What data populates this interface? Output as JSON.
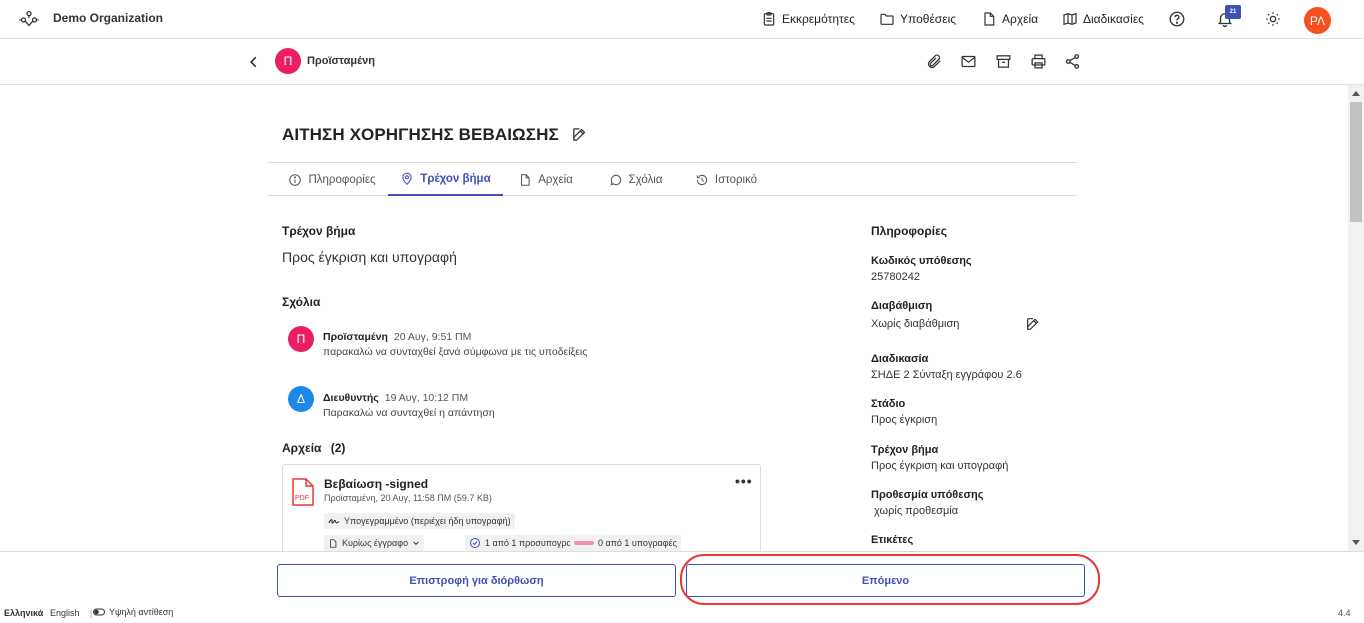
{
  "header": {
    "org_name": "Demo Organization",
    "nav": [
      {
        "label": "Εκκρεμότητες",
        "icon": "clipboard-icon"
      },
      {
        "label": "Υποθέσεις",
        "icon": "folder-icon"
      },
      {
        "label": "Αρχεία",
        "icon": "file-icon"
      },
      {
        "label": "Διαδικασίες",
        "icon": "map-icon"
      }
    ],
    "notifications_count": "21",
    "user_initials": "ΡΛ"
  },
  "subheader": {
    "avatar_letter": "Π",
    "user_name": "Προϊσταμένη"
  },
  "document": {
    "title": "ΑΙΤΗΣΗ ΧΟΡΗΓΗΣΗΣ ΒΕΒΑΙΩΣΗΣ",
    "tabs": [
      {
        "label": "Πληροφορίες"
      },
      {
        "label": "Τρέχον βήμα"
      },
      {
        "label": "Αρχεία"
      },
      {
        "label": "Σχόλια"
      },
      {
        "label": "Ιστορικό"
      }
    ],
    "active_tab": "Τρέχον βήμα"
  },
  "current_step": {
    "heading": "Τρέχον βήμα",
    "value": "Προς έγκριση και υπογραφή"
  },
  "comments": {
    "heading": "Σχόλια",
    "items": [
      {
        "avatar": "Π",
        "author": "Προϊσταμένη",
        "time": "20 Αυγ, 9:51 ΠΜ",
        "text": "παρακαλώ να συνταχθεί ξανά σύμφωνα με τις υποδείξεις",
        "color": "#e91e63"
      },
      {
        "avatar": "Δ",
        "author": "Διευθυντής",
        "time": "19 Αυγ, 10:12 ΠΜ",
        "text": "Παρακαλώ να συνταχθεί η απάντηση",
        "color": "#1e88e5"
      }
    ]
  },
  "files": {
    "heading": "Αρχεία",
    "count": "(2)",
    "items": [
      {
        "icon_label": "PDF",
        "name": "Βεβαίωση -signed",
        "meta": "Προϊσταμένη,  20 Αυγ, 11:58 ΠΜ (59.7 KB)",
        "signed_label": "Υπογεγραμμένο (περιέχει ήδη υπογραφή)",
        "type_label": "Κυρίως έγγραφο",
        "initials_label": "1 από 1 προσυπογραφές",
        "signatures_label": "0 από 1 υπογραφές"
      }
    ]
  },
  "info": {
    "heading": "Πληροφορίες",
    "fields": [
      {
        "label": "Κωδικός υπόθεσης",
        "value": "25780242"
      },
      {
        "label": "Διαβάθμιση",
        "value": "Χωρίς διαβάθμιση"
      },
      {
        "label": "Διαδικασία",
        "value": "ΣΗΔΕ 2 Σύνταξη εγγράφου 2.6"
      },
      {
        "label": "Στάδιο",
        "value": "Προς έγκριση"
      },
      {
        "label": "Τρέχον βήμα",
        "value": "Προς έγκριση και υπογραφή"
      },
      {
        "label": "Προθεσμία υπόθεσης",
        "value": " χωρίς προθεσμία"
      },
      {
        "label": "Ετικέτες",
        "value": ""
      }
    ]
  },
  "actions": {
    "return_label": "Επιστροφή για διόρθωση",
    "next_label": "Επόμενο"
  },
  "footer": {
    "lang_greek": "Ελληνικά",
    "lang_english": "English",
    "contrast_label": "Υψηλή αντίθεση",
    "version": "4.4"
  },
  "colors": {
    "accent": "#3f51b5",
    "highlight": "#e53935",
    "user_avatar": "#f4511e"
  }
}
